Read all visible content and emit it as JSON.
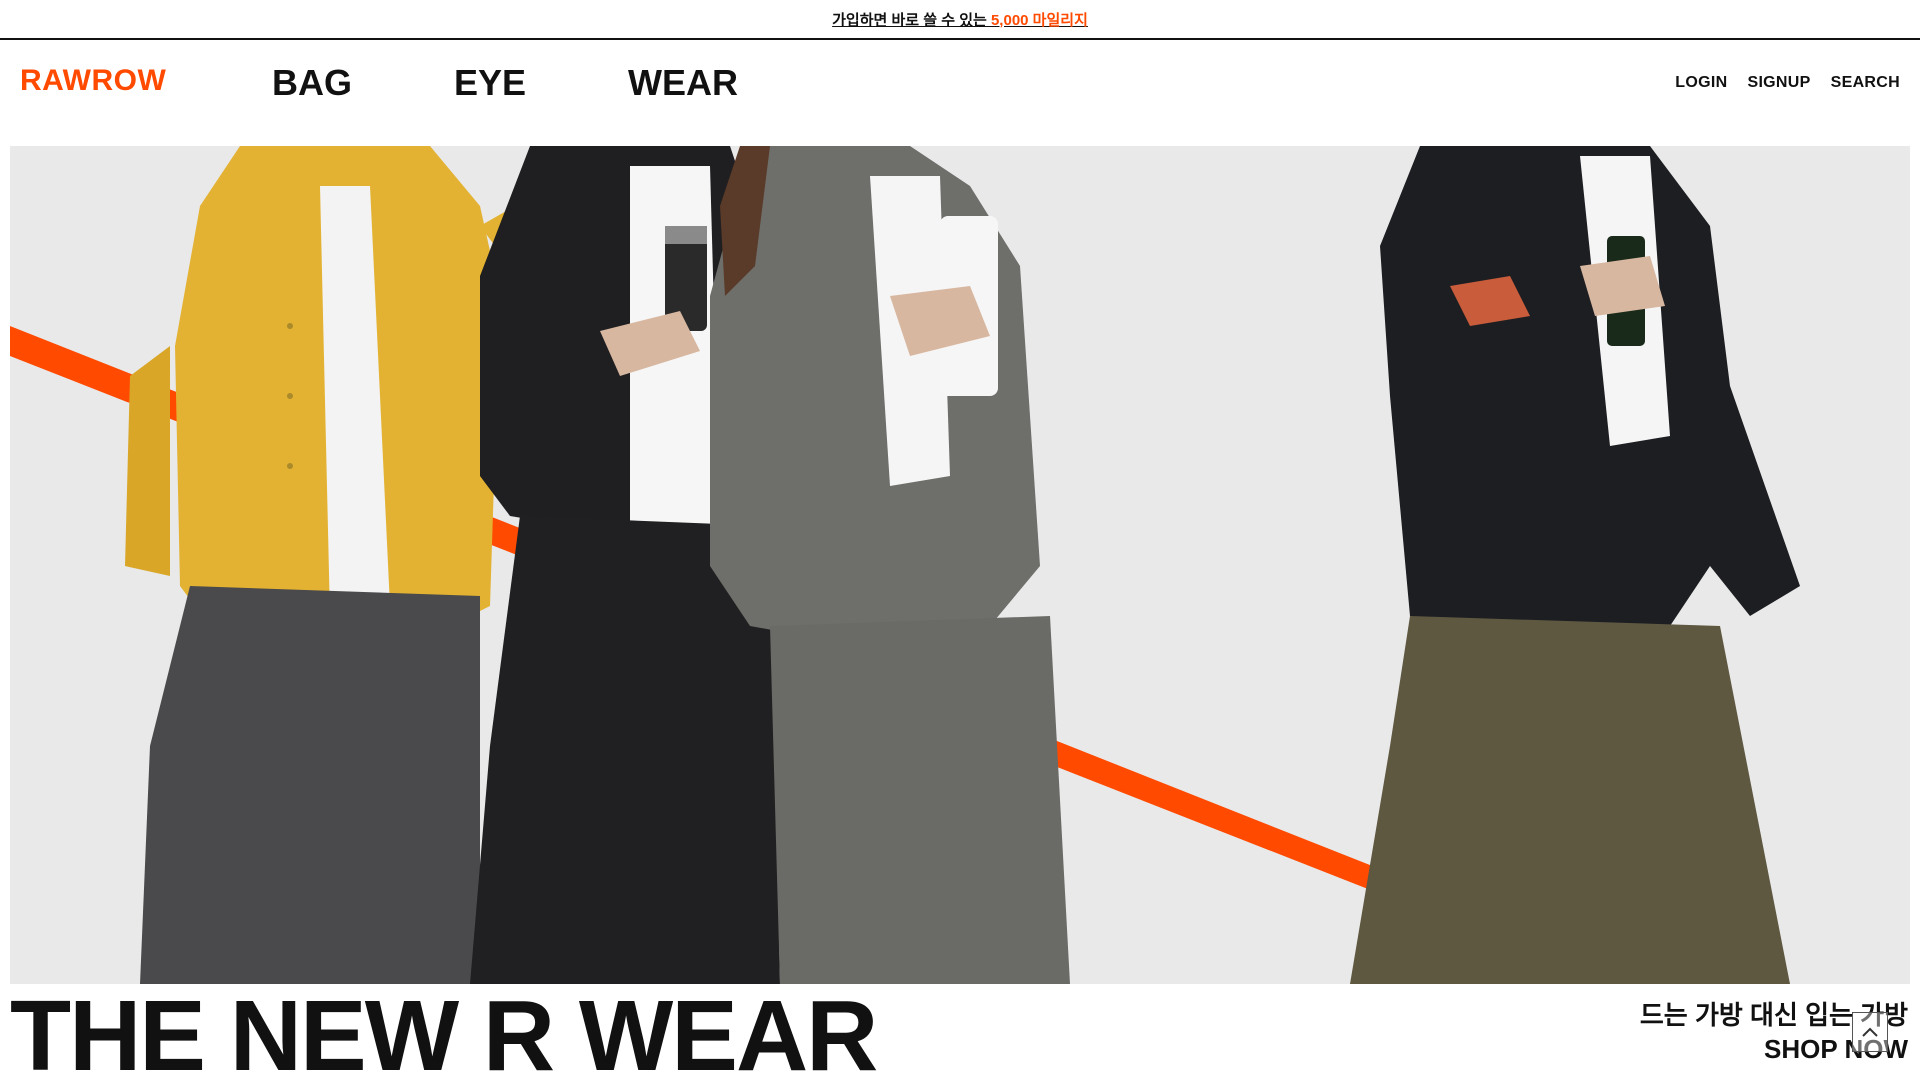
{
  "promo": {
    "text_prefix": "가입하면 바로 쓸 수 있는 ",
    "text_highlight": "5,000 마일리지"
  },
  "header": {
    "logo": "RAWROW",
    "nav": [
      "BAG",
      "EYE",
      "WEAR"
    ],
    "util": [
      "LOGIN",
      "SIGNUP",
      "SEARCH"
    ]
  },
  "hero": {
    "headline": "THE NEW R WEAR",
    "tagline": "드는 가방 대신 입는 가방",
    "cta": "SHOP NOW"
  },
  "colors": {
    "accent": "#ff4a00",
    "text": "#111111",
    "hero_bg": "#e9e9e9"
  },
  "icons": {
    "scroll_top": "chevron-up-icon"
  }
}
